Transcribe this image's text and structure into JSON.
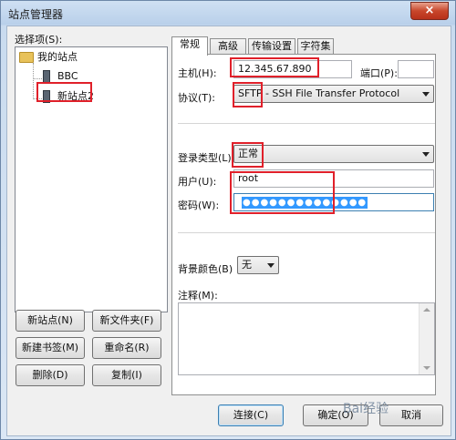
{
  "window": {
    "title": "站点管理器",
    "close_glyph": "×"
  },
  "left": {
    "select_label": "选择项(S):",
    "tree": {
      "root": "我的站点",
      "children": [
        "BBC",
        "新站点2"
      ]
    },
    "buttons": {
      "new_site": "新站点(N)",
      "new_folder": "新文件夹(F)",
      "new_bookmark": "新建书签(M)",
      "rename": "重命名(R)",
      "delete": "删除(D)",
      "copy": "复制(I)"
    }
  },
  "tabs": [
    "常规",
    "高级",
    "传输设置",
    "字符集"
  ],
  "general": {
    "host_label": "主机(H):",
    "host_value": "12.345.67.890",
    "port_label": "端口(P):",
    "port_value": "",
    "protocol_label": "协议(T):",
    "protocol_value": "SFTP - SSH File Transfer Protocol",
    "logon_label": "登录类型(L):",
    "logon_value": "正常",
    "user_label": "用户(U):",
    "user_value": "root",
    "password_label": "密码(W):",
    "password_value": "●●●●●●●●●●●●●●",
    "bgcolor_label": "背景颜色(B)",
    "bgcolor_value": "无",
    "notes_label": "注释(M):"
  },
  "footer": {
    "connect": "连接(C)",
    "ok": "确定(O)",
    "cancel": "取消"
  },
  "watermark": "Bai经验",
  "colors": {
    "highlight": "#e0202a",
    "selection": "#3399ff"
  },
  "icons": [
    "folder-icon",
    "server-icon",
    "close-icon",
    "chevron-down-icon"
  ]
}
